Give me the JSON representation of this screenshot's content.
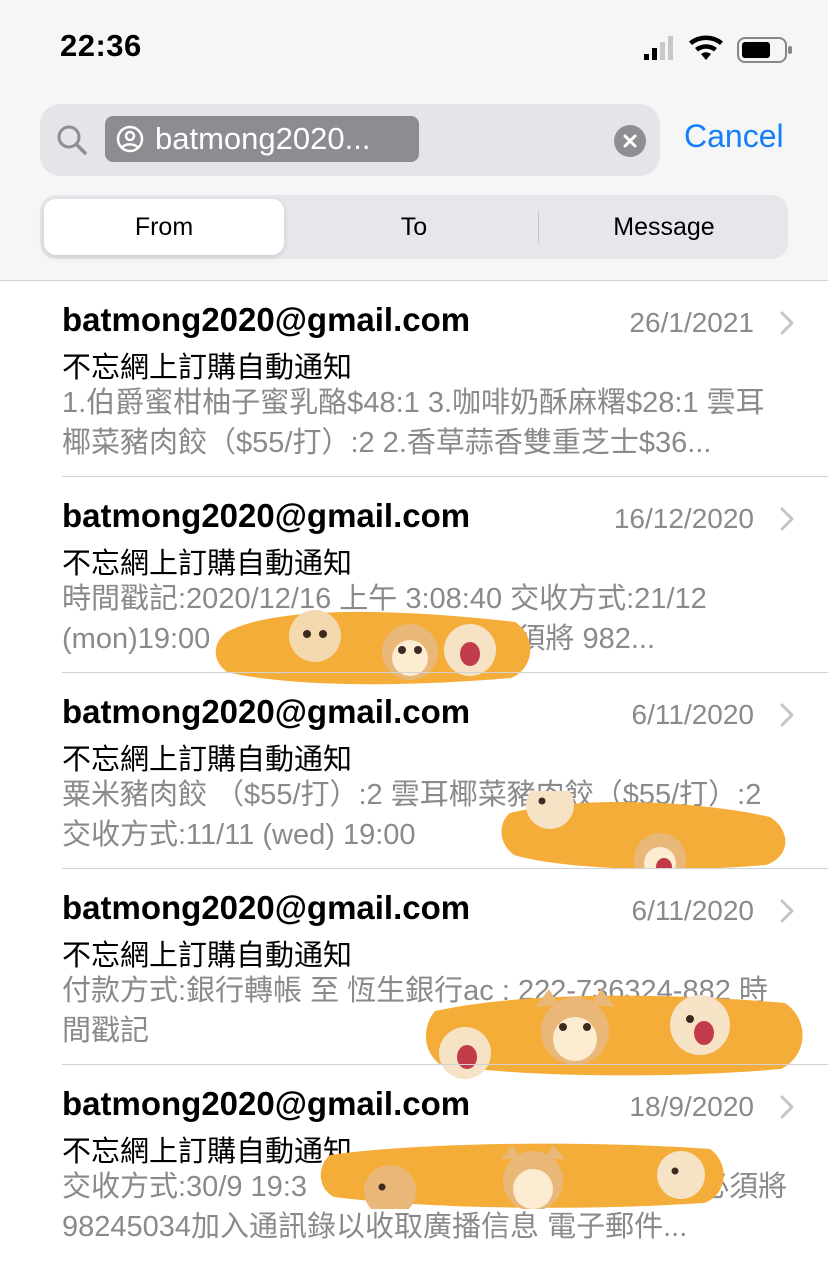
{
  "status": {
    "time": "22:36",
    "icons": [
      "cellular-signal-icon",
      "wifi-icon",
      "battery-icon"
    ]
  },
  "search": {
    "token_text": "batmong2020...",
    "cancel_label": "Cancel"
  },
  "scopes": {
    "items": [
      {
        "label": "From",
        "selected": true
      },
      {
        "label": "To",
        "selected": false
      },
      {
        "label": "Message",
        "selected": false
      }
    ]
  },
  "colors": {
    "accent": "#147efb",
    "secondary_text": "#8a8a8e",
    "sticker_orange": "#f5ad3a"
  },
  "emails": [
    {
      "sender": "batmong2020@gmail.com",
      "date": "26/1/2021",
      "subject": "不忘網上訂購自動通知",
      "preview": "1.伯爵蜜柑柚子蜜乳酪$48:1 3.咖啡奶酥麻糬$28:1 雲耳椰菜豬肉餃（$55/打）:2 2.香草蒜香雙重芝士$36..."
    },
    {
      "sender": "batmong2020@gmail.com",
      "date": "16/12/2020",
      "subject": "不忘網上訂購自動通知",
      "preview": "時間戳記:2020/12/16 上午 3:08:40 交收方式:21/12 (mon)19:00 　　　　　　街附近 必須將 982..."
    },
    {
      "sender": "batmong2020@gmail.com",
      "date": "6/11/2020",
      "subject": "不忘網上訂購自動通知",
      "preview": "粟米豬肉餃 （$55/打）:2 雲耳椰菜豬肉餃（$55/打）:2 交收方式:11/11 (wed) 19:00"
    },
    {
      "sender": "batmong2020@gmail.com",
      "date": "6/11/2020",
      "subject": "不忘網上訂購自動通知",
      "preview": "付款方式:銀行轉帳 至 恆生銀行ac : 222-736324-882 時間戳記"
    },
    {
      "sender": "batmong2020@gmail.com",
      "date": "18/9/2020",
      "subject": "不忘網上訂購自動通知",
      "preview": "交收方式:30/9 19:3 　　　　　　　　　　　　　 必須將98245034加入通訊錄以收取廣播信息 電子郵件..."
    }
  ]
}
